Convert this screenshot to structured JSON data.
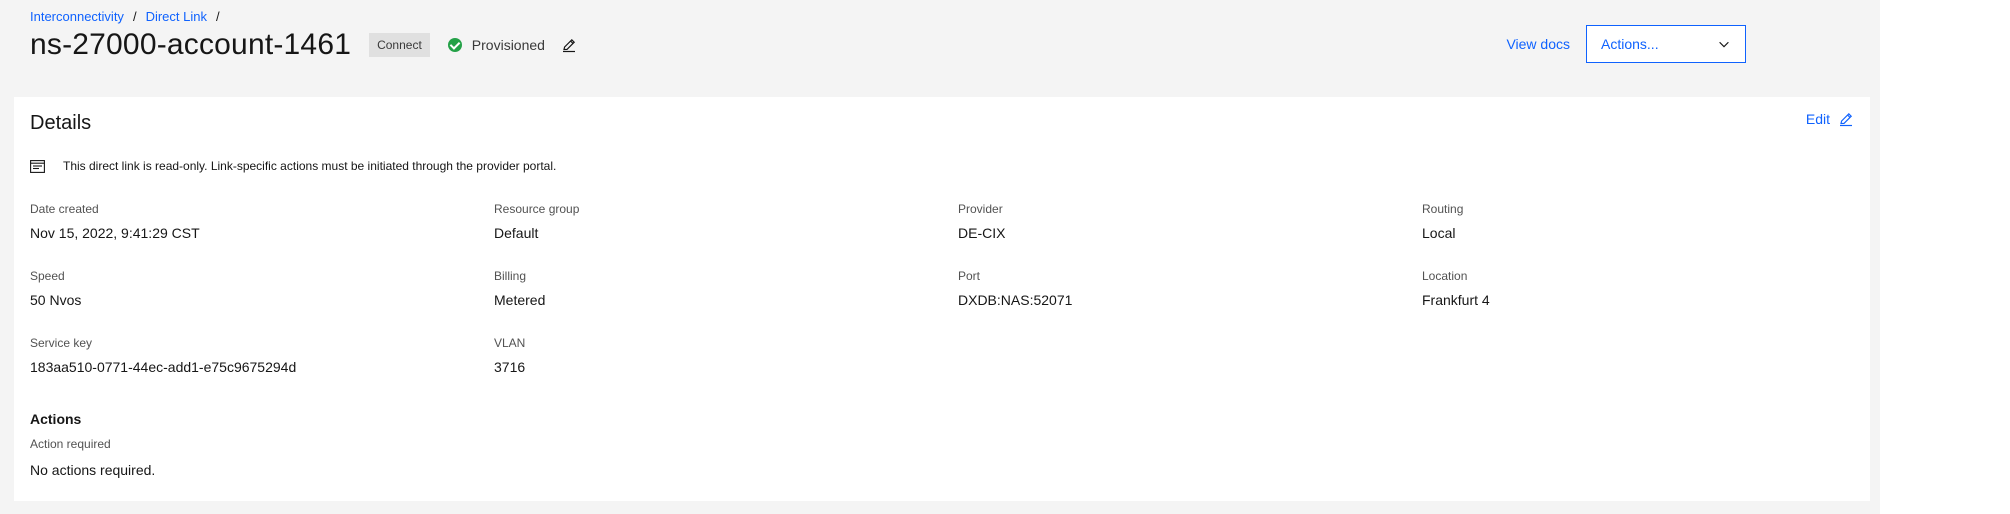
{
  "breadcrumb": {
    "items": [
      "Interconnectivity",
      "Direct Link"
    ],
    "separator": "/"
  },
  "header": {
    "title": "ns-27000-account-1461",
    "tag": "Connect",
    "status": "Provisioned",
    "status_color": "#24a148",
    "view_docs": "View docs",
    "actions_label": "Actions..."
  },
  "details": {
    "title": "Details",
    "edit_label": "Edit",
    "notice": "This direct link is read-only. Link-specific actions must be initiated through the provider portal.",
    "fields": [
      {
        "label": "Date created",
        "value": "Nov 15, 2022, 9:41:29 CST"
      },
      {
        "label": "Resource group",
        "value": "Default"
      },
      {
        "label": "Provider",
        "value": "DE-CIX"
      },
      {
        "label": "Routing",
        "value": "Local"
      },
      {
        "label": "Speed",
        "value": "50 Nvos"
      },
      {
        "label": "Billing",
        "value": "Metered"
      },
      {
        "label": "Port",
        "value": "DXDB:NAS:52071"
      },
      {
        "label": "Location",
        "value": "Frankfurt 4"
      },
      {
        "label": "Service key",
        "value": "183aa510-0771-44ec-add1-e75c9675294d"
      },
      {
        "label": "VLAN",
        "value": "3716"
      }
    ]
  },
  "actions_section": {
    "heading": "Actions",
    "sub": "Action required",
    "text": "No actions required."
  },
  "colors": {
    "accent": "#0f62fe",
    "background": "#f4f4f4"
  }
}
